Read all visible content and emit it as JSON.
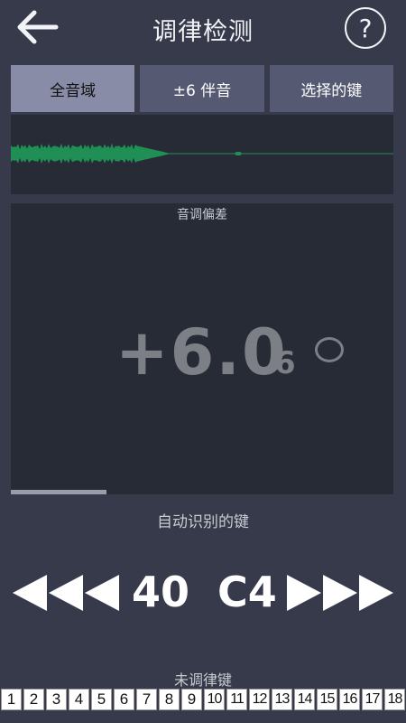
{
  "header": {
    "title": "调律检测",
    "help_label": "?"
  },
  "tabs": [
    {
      "label": "全音域",
      "active": true
    },
    {
      "label": "±6 伴音",
      "active": false
    },
    {
      "label": "选择的键",
      "active": false
    }
  ],
  "deviation": {
    "label": "音调偏差",
    "value": "+6.0",
    "sub_digit": "6",
    "progress": 0.25
  },
  "auto_key": {
    "label": "自动识别的键",
    "number": "40",
    "note": "C4"
  },
  "untuned": {
    "label": "未调律键",
    "keys": [
      "1",
      "2",
      "3",
      "4",
      "5",
      "6",
      "7",
      "8",
      "9",
      "10",
      "11",
      "12",
      "13",
      "14",
      "15",
      "16",
      "17",
      "18"
    ]
  },
  "colors": {
    "background": "#363a4b",
    "panel": "#272b36",
    "tab_active": "#888ca6",
    "tab_inactive": "#555a72",
    "waveform": "#1f8f55"
  }
}
